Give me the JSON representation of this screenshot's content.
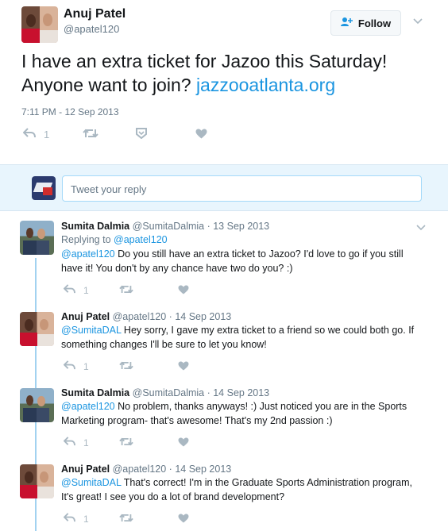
{
  "main_tweet": {
    "author_name": "Anuj Patel",
    "author_handle": "@apatel120",
    "follow_label": "Follow",
    "text_prefix": "I have an extra ticket for Jazoo this Saturday! Anyone want to join? ",
    "link_text": "jazzooatlanta.org",
    "timestamp": "7:11 PM - 12 Sep 2013",
    "reply_count": "1"
  },
  "reply_box": {
    "placeholder": "Tweet your reply"
  },
  "replies": [
    {
      "author_name": "Sumita Dalmia",
      "meta": "@SumitaDalmia · 13 Sep 2013",
      "replying_prefix": "Replying to ",
      "replying_to": "@apatel120",
      "mention": "@apatel120",
      "text": " Do you still have an extra ticket to Jazoo? I'd love to go if you still have it! You don't by any chance have two do you? :)",
      "reply_count": "1"
    },
    {
      "author_name": "Anuj Patel",
      "meta": "@apatel120 · 14 Sep 2013",
      "mention": "@SumitaDAL",
      "text": " Hey sorry, I gave my extra ticket to a friend so we could both go. If something changes I'll be sure to let you know!",
      "reply_count": "1"
    },
    {
      "author_name": "Sumita Dalmia",
      "meta": "@SumitaDalmia · 14 Sep 2013",
      "mention": "@apatel120",
      "text": " No problem, thanks anyways! :) Just noticed you are in the Sports Marketing program- that's awesome! That's my 2nd passion :)",
      "reply_count": "1"
    },
    {
      "author_name": "Anuj Patel",
      "meta": "@apatel120 · 14 Sep 2013",
      "mention": "@SumitaDAL",
      "text": " That's correct! I'm in the Graduate Sports Administration program, It's great! I see you do a lot of brand development?",
      "reply_count": "1"
    }
  ],
  "icons": {
    "reply": "reply-icon",
    "retweet": "retweet-icon",
    "dm": "direct-message-icon",
    "like": "heart-icon",
    "more": "chevron-down-icon",
    "follow": "person-add-icon"
  },
  "colors": {
    "link": "#1b95e0",
    "thread_line": "#a2d2f0",
    "reply_box_bg": "#e8f5fd",
    "icon_gray": "#aab8c2"
  }
}
